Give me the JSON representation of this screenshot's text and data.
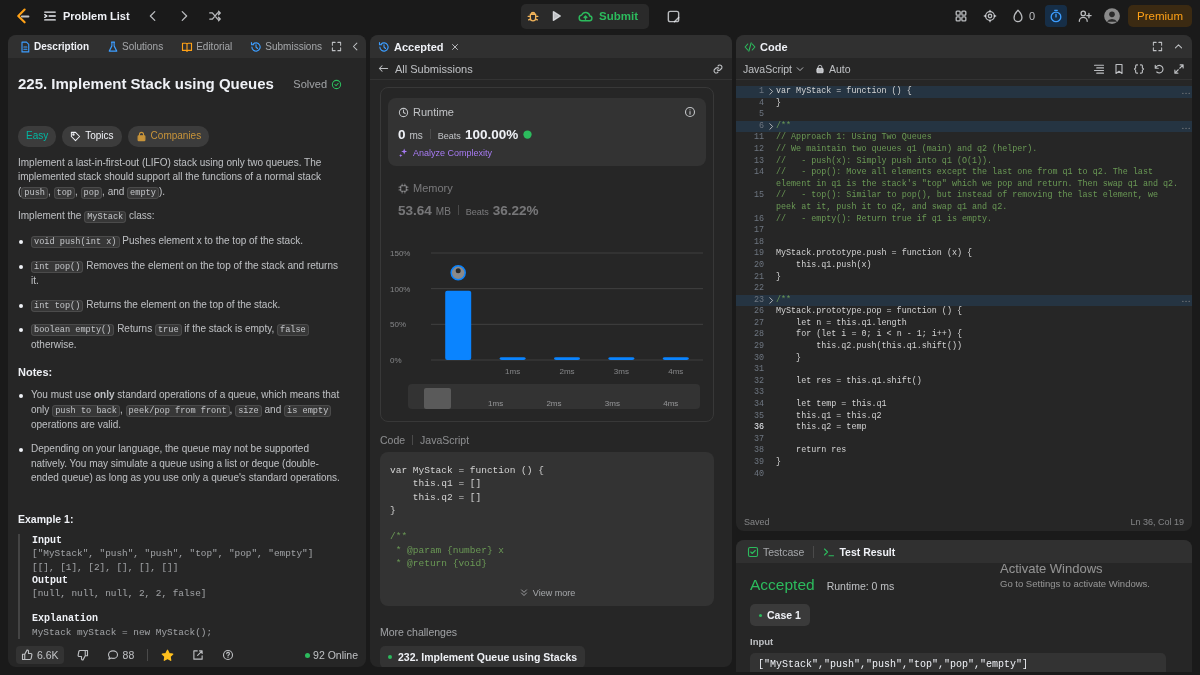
{
  "top_bar": {
    "title": "Problem List",
    "submit": "Submit",
    "streak": "0",
    "premium": "Premium"
  },
  "description_panel": {
    "tabs": [
      {
        "label": "Description",
        "kind": "description",
        "selected": true
      },
      {
        "label": "Solutions",
        "kind": "solutions",
        "selected": false
      },
      {
        "label": "Editorial",
        "kind": "editorial",
        "selected": false
      },
      {
        "label": "Submissions",
        "kind": "submissions",
        "selected": false
      }
    ],
    "title": "225. Implement Stack using Queues",
    "status": "Solved",
    "tags": [
      {
        "label": "Easy",
        "kind": "difficulty"
      },
      {
        "label": "Topics",
        "kind": "topics"
      },
      {
        "label": "Companies",
        "kind": "companies"
      }
    ],
    "blocks": [
      {
        "kind": "paragraph",
        "parts": [
          {
            "kind": "text",
            "text": "Implement a last-in-first-out (LIFO) stack using only two queues. The implemented stack should support all the functions of a normal stack ("
          },
          {
            "kind": "code",
            "text": "push"
          },
          {
            "kind": "text",
            "text": ", "
          },
          {
            "kind": "code",
            "text": "top"
          },
          {
            "kind": "text",
            "text": ", "
          },
          {
            "kind": "code",
            "text": "pop"
          },
          {
            "kind": "text",
            "text": ", and "
          },
          {
            "kind": "code",
            "text": "empty"
          },
          {
            "kind": "text",
            "text": ")."
          }
        ]
      },
      {
        "kind": "paragraph",
        "parts": [
          {
            "kind": "text",
            "text": "Implement the "
          },
          {
            "kind": "code",
            "text": "MyStack"
          },
          {
            "kind": "text",
            "text": " class:"
          }
        ]
      },
      {
        "kind": "bullet",
        "parts": [
          {
            "kind": "code",
            "text": "void push(int x)"
          },
          {
            "kind": "text",
            "text": " Pushes element x to the top of the stack."
          }
        ]
      },
      {
        "kind": "bullet",
        "parts": [
          {
            "kind": "code",
            "text": "int pop()"
          },
          {
            "kind": "text",
            "text": " Removes the element on the top of the stack and returns it."
          }
        ]
      },
      {
        "kind": "bullet",
        "parts": [
          {
            "kind": "code",
            "text": "int top()"
          },
          {
            "kind": "text",
            "text": " Returns the element on the top of the stack."
          }
        ]
      },
      {
        "kind": "bullet",
        "parts": [
          {
            "kind": "code",
            "text": "boolean empty()"
          },
          {
            "kind": "text",
            "text": " Returns "
          },
          {
            "kind": "code",
            "text": "true"
          },
          {
            "kind": "text",
            "text": " if the stack is empty, "
          },
          {
            "kind": "code",
            "text": "false"
          },
          {
            "kind": "text",
            "text": " otherwise."
          }
        ]
      },
      {
        "kind": "heading",
        "parts": [
          {
            "kind": "text",
            "text": "Notes:"
          }
        ]
      },
      {
        "kind": "bullet",
        "parts": [
          {
            "kind": "text",
            "text": "You must use **only** standard operations of a queue, which means that only "
          },
          {
            "kind": "code",
            "text": "push to back"
          },
          {
            "kind": "text",
            "text": ", "
          },
          {
            "kind": "code",
            "text": "peek/pop from front"
          },
          {
            "kind": "text",
            "text": ", "
          },
          {
            "kind": "code",
            "text": "size"
          },
          {
            "kind": "text",
            "text": " and "
          },
          {
            "kind": "code",
            "text": "is empty"
          },
          {
            "kind": "text",
            "text": " operations are valid."
          }
        ]
      },
      {
        "kind": "bullet",
        "parts": [
          {
            "kind": "text",
            "text": "Depending on your language, the queue may not be supported natively. You may simulate a queue using a list or deque (double-ended queue) as long as you use only a queue's standard operations."
          }
        ]
      }
    ],
    "example": {
      "title": "Example 1:",
      "lines": [
        {
          "kind": "label",
          "text": "Input"
        },
        {
          "kind": "value",
          "text": "[\"MyStack\", \"push\", \"push\", \"top\", \"pop\", \"empty\"]"
        },
        {
          "kind": "value",
          "text": "[[], [1], [2], [], [], []]"
        },
        {
          "kind": "label",
          "text": "Output"
        },
        {
          "kind": "value",
          "text": "[null, null, null, 2, 2, false]"
        },
        {
          "kind": "section",
          "text": "Explanation"
        },
        {
          "kind": "value",
          "text": "MyStack myStack = new MyStack();"
        }
      ]
    },
    "footer": {
      "likes": "6.6K",
      "comments": "88",
      "starred": true,
      "online": "92 Online"
    }
  },
  "submission_panel": {
    "tab": "Accepted",
    "back": "All Submissions",
    "metrics": [
      {
        "kind": "runtime",
        "label": "Runtime",
        "value": "0",
        "unit": "ms",
        "beats_label": "Beats",
        "beats": "100.00%",
        "action": "Analyze Complexity",
        "selected": true
      },
      {
        "kind": "memory",
        "label": "Memory",
        "value": "53.64",
        "unit": "MB",
        "beats_label": "Beats",
        "beats": "36.22%",
        "selected": false
      }
    ],
    "chart_data": {
      "type": "bar",
      "categories": [
        null,
        "1ms",
        "2ms",
        "3ms",
        "4ms"
      ],
      "values": [
        97,
        4,
        4,
        4,
        4
      ],
      "ylim": [
        0,
        150
      ],
      "yticks": [
        {
          "value": 0,
          "label": "0%"
        },
        {
          "value": 50,
          "label": "50%"
        },
        {
          "value": 100,
          "label": "100%"
        },
        {
          "value": 150,
          "label": "150%"
        }
      ]
    },
    "overview_labels": [
      "1ms",
      "2ms",
      "3ms",
      "4ms"
    ],
    "code_label": "Code",
    "code_language": "JavaScript",
    "code_preview": [
      {
        "kind": "code",
        "text": "var MyStack = function () {"
      },
      {
        "kind": "code",
        "text": "    this.q1 = []"
      },
      {
        "kind": "code",
        "text": "    this.q2 = []"
      },
      {
        "kind": "code",
        "text": "}"
      },
      {
        "kind": "blank"
      },
      {
        "kind": "comment",
        "text": "/**"
      },
      {
        "kind": "comment",
        "text": " * @param {number} x"
      },
      {
        "kind": "comment",
        "text": " * @return {void}"
      }
    ],
    "view_more": "View more",
    "more_title": "More challenges",
    "challenges": [
      "232. Implement Queue using Stacks"
    ]
  },
  "editor": {
    "title": "Code",
    "language": "JavaScript",
    "mode": "Auto",
    "lines": [
      {
        "n": "1",
        "kind": "code",
        "text": "var MyStack = function () {",
        "folded": true,
        "current": false
      },
      {
        "n": "4",
        "kind": "code",
        "text": "}",
        "folded": false,
        "current": false
      },
      {
        "n": "5",
        "kind": "blank",
        "folded": false,
        "current": false
      },
      {
        "n": "6",
        "kind": "comment",
        "text": "/**",
        "folded": true,
        "current": false
      },
      {
        "n": "11",
        "kind": "comment",
        "text": "// Approach 1: Using Two Queues",
        "folded": false,
        "current": false
      },
      {
        "n": "12",
        "kind": "comment",
        "text": "// We maintain two queues q1 (main) and q2 (helper).",
        "folded": false,
        "current": false
      },
      {
        "n": "13",
        "kind": "comment",
        "text": "//   - push(x): Simply push into q1 (O(1)).",
        "folded": false,
        "current": false
      },
      {
        "n": "14",
        "kind": "comment",
        "text": "//   - pop(): Move all elements except the last one from q1 to q2. The last element in q1 is the stack's \"top\" which we pop and return. Then swap q1 and q2.",
        "folded": false,
        "current": false
      },
      {
        "n": "15",
        "kind": "comment",
        "text": "//   - top(): Similar to pop(), but instead of removing the last element, we peek at it, push it to q2, and swap q1 and q2.",
        "folded": false,
        "current": false
      },
      {
        "n": "16",
        "kind": "comment",
        "text": "//   - empty(): Return true if q1 is empty.",
        "folded": false,
        "current": false
      },
      {
        "n": "17",
        "kind": "blank",
        "folded": false,
        "current": false
      },
      {
        "n": "18",
        "kind": "blank",
        "folded": false,
        "current": false
      },
      {
        "n": "19",
        "kind": "code",
        "text": "MyStack.prototype.push = function (x) {",
        "folded": false,
        "current": false
      },
      {
        "n": "20",
        "kind": "code",
        "text": "    this.q1.push(x)",
        "folded": false,
        "current": false
      },
      {
        "n": "21",
        "kind": "code",
        "text": "}",
        "folded": false,
        "current": false
      },
      {
        "n": "22",
        "kind": "blank",
        "folded": false,
        "current": false
      },
      {
        "n": "23",
        "kind": "comment",
        "text": "/**",
        "folded": true,
        "current": false
      },
      {
        "n": "26",
        "kind": "code",
        "text": "MyStack.prototype.pop = function () {",
        "folded": false,
        "current": false
      },
      {
        "n": "27",
        "kind": "code",
        "text": "    let n = this.q1.length",
        "folded": false,
        "current": false
      },
      {
        "n": "28",
        "kind": "code",
        "text": "    for (let i = 0; i < n - 1; i++) {",
        "folded": false,
        "current": false
      },
      {
        "n": "29",
        "kind": "code",
        "text": "        this.q2.push(this.q1.shift())",
        "folded": false,
        "current": false
      },
      {
        "n": "30",
        "kind": "code",
        "text": "    }",
        "folded": false,
        "current": false
      },
      {
        "n": "31",
        "kind": "blank",
        "folded": false,
        "current": false
      },
      {
        "n": "32",
        "kind": "code",
        "text": "    let res = this.q1.shift()",
        "folded": false,
        "current": false
      },
      {
        "n": "33",
        "kind": "blank",
        "folded": false,
        "current": false
      },
      {
        "n": "34",
        "kind": "code",
        "text": "    let temp = this.q1",
        "folded": false,
        "current": false
      },
      {
        "n": "35",
        "kind": "code",
        "text": "    this.q1 = this.q2",
        "folded": false,
        "current": false
      },
      {
        "n": "36",
        "kind": "code",
        "text": "    this.q2 = temp",
        "folded": false,
        "current": true
      },
      {
        "n": "37",
        "kind": "blank",
        "folded": false,
        "current": false
      },
      {
        "n": "38",
        "kind": "code",
        "text": "    return res",
        "folded": false,
        "current": false
      },
      {
        "n": "39",
        "kind": "code",
        "text": "}",
        "folded": false,
        "current": false
      },
      {
        "n": "40",
        "kind": "blank",
        "folded": false,
        "current": false
      }
    ],
    "status": "Saved",
    "cursor": "Ln 36, Col 19"
  },
  "result_panel": {
    "tabs": [
      {
        "label": "Testcase",
        "kind": "testcase",
        "selected": false
      },
      {
        "label": "Test Result",
        "kind": "result",
        "selected": true
      }
    ],
    "verdict": "Accepted",
    "runtime": "Runtime: 0 ms",
    "cases": [
      {
        "label": "Case 1",
        "selected": true
      }
    ],
    "input_label": "Input",
    "input_value": "[\"MyStack\",\"push\",\"push\",\"top\",\"pop\",\"empty\"]"
  },
  "os_notice": {
    "title": "Activate Windows",
    "text": "Go to Settings to activate Windows."
  }
}
